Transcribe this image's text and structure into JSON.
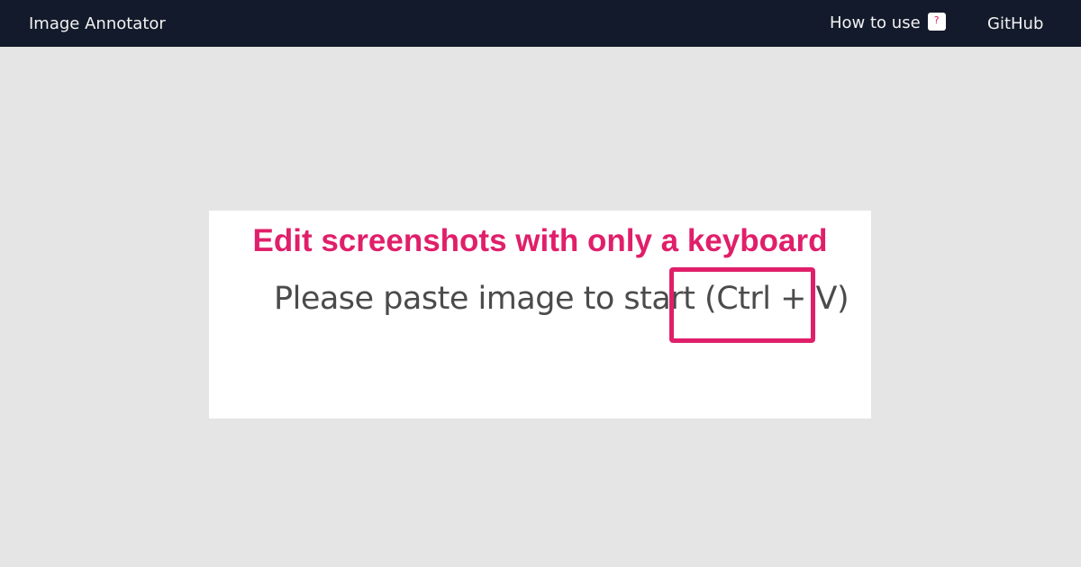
{
  "header": {
    "title": "Image Annotator",
    "nav": {
      "how_to_use": "How to use",
      "help_badge": "?",
      "github": "GitHub"
    }
  },
  "main": {
    "headline": "Edit screenshots with only a keyboard",
    "prompt_text": "Please paste image to start",
    "shortcut_text": " (Ctrl + V)"
  },
  "colors": {
    "topbar": "#131a2b",
    "background": "#e5e5e5",
    "accent": "#e01f6a",
    "prompt_text": "#4b4b4b"
  },
  "icons": {
    "help_badge": "question-mark-icon"
  }
}
